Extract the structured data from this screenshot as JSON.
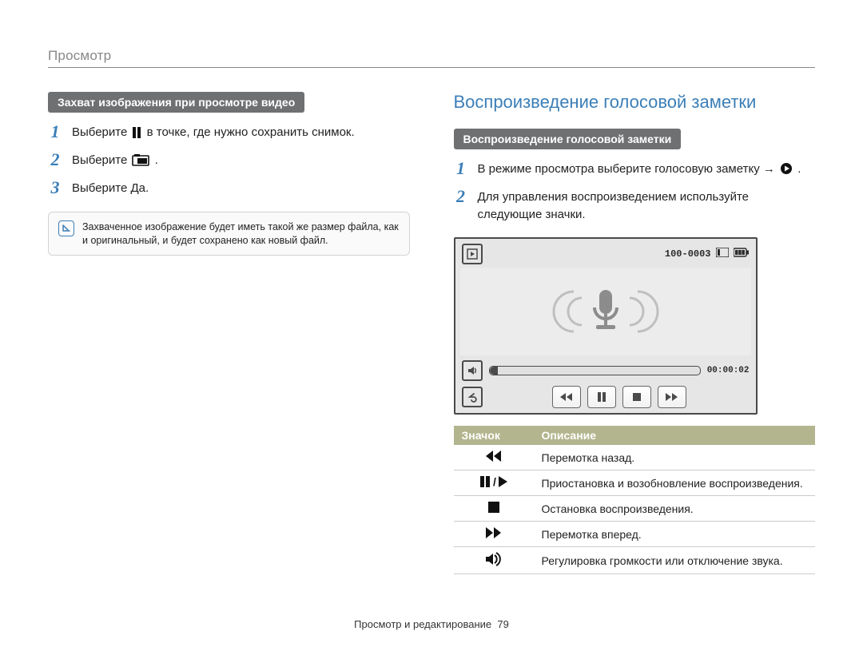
{
  "section": "Просмотр",
  "left": {
    "header": "Захват изображения при просмотре видео",
    "steps": [
      {
        "pre": "Выберите ",
        "post": " в точке, где нужно сохранить снимок."
      },
      {
        "pre": "Выберите ",
        "post": "."
      },
      {
        "full": "Выберите Да."
      }
    ],
    "note": "Захваченное изображение будет иметь такой же размер файла, как и оригинальный, и будет сохранено как новый файл."
  },
  "right": {
    "title": "Воспроизведение голосовой заметки",
    "header": "Воспроизведение голосовой заметки",
    "steps": [
      {
        "pre": "В режиме просмотра выберите голосовую заметку → ",
        "post": "."
      },
      {
        "full": "Для управления воспроизведением используйте следующие значки."
      }
    ],
    "player": {
      "file_counter": "100-0003",
      "time": "00:00:02"
    },
    "table": {
      "col_icon": "Значок",
      "col_desc": "Описание",
      "rows": [
        {
          "icon": "rewind",
          "desc": "Перемотка назад."
        },
        {
          "icon": "pauseplay",
          "desc": "Приостановка и возобновление воспроизведения."
        },
        {
          "icon": "stop",
          "desc": "Остановка воспроизведения."
        },
        {
          "icon": "forward",
          "desc": "Перемотка вперед."
        },
        {
          "icon": "volume",
          "desc": "Регулировка громкости или отключение звука."
        }
      ]
    }
  },
  "footer": {
    "chapter": "Просмотр и редактирование",
    "page": "79"
  }
}
